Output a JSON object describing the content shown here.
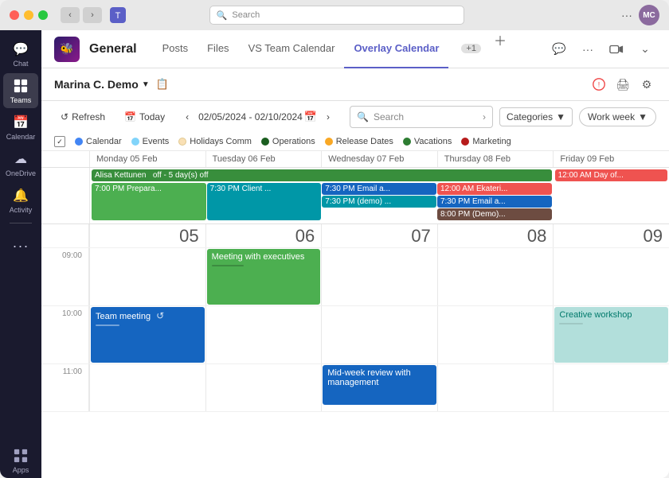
{
  "titlebar": {
    "search_placeholder": "Search",
    "more_label": "···",
    "teams_icon": "⊞"
  },
  "sidebar": {
    "items": [
      {
        "id": "chat",
        "label": "Chat",
        "icon": "💬",
        "active": false
      },
      {
        "id": "teams",
        "label": "Teams",
        "icon": "⊞",
        "active": true
      },
      {
        "id": "calendar",
        "label": "Calendar",
        "icon": "📅",
        "active": false
      },
      {
        "id": "onedrive",
        "label": "OneDrive",
        "icon": "☁",
        "active": false
      },
      {
        "id": "activity",
        "label": "Activity",
        "icon": "🔔",
        "active": false
      },
      {
        "id": "more",
        "label": "···",
        "icon": "···",
        "active": false
      },
      {
        "id": "apps",
        "label": "Apps",
        "icon": "⊞",
        "active": false
      }
    ]
  },
  "channel": {
    "logo": "🐝",
    "name": "General",
    "tabs": [
      {
        "id": "posts",
        "label": "Posts",
        "active": false
      },
      {
        "id": "files",
        "label": "Files",
        "active": false
      },
      {
        "id": "vs-team-calendar",
        "label": "VS Team Calendar",
        "active": false
      },
      {
        "id": "overlay-calendar",
        "label": "Overlay Calendar",
        "active": true
      },
      {
        "id": "plus-badge",
        "label": "+1",
        "active": false
      }
    ]
  },
  "calendar": {
    "user": "Marina C. Demo",
    "view": "Work week",
    "date_range": "02/05/2024 - 02/10/2024",
    "search_placeholder": "Search",
    "categories_label": "Categories",
    "refresh_label": "Refresh",
    "today_label": "Today",
    "legend": [
      {
        "id": "calendar",
        "label": "Calendar",
        "color": "#4285f4"
      },
      {
        "id": "events",
        "label": "Events",
        "color": "#81d4fa"
      },
      {
        "id": "holidays",
        "label": "Holidays Comm",
        "color": "#f9e0b5"
      },
      {
        "id": "operations",
        "label": "Operations",
        "color": "#1b5e20"
      },
      {
        "id": "release",
        "label": "Release Dates",
        "color": "#f9a825"
      },
      {
        "id": "vacations",
        "label": "Vacations",
        "color": "#2e7d32"
      },
      {
        "id": "marketing",
        "label": "Marketing",
        "color": "#b71c1c"
      }
    ],
    "days": [
      {
        "name": "Monday 05 Feb",
        "num": "05"
      },
      {
        "name": "Tuesday 06 Feb",
        "num": "06"
      },
      {
        "name": "Wednesday 07 Feb",
        "num": "07"
      },
      {
        "name": "Thursday 08 Feb",
        "num": "08"
      },
      {
        "name": "Friday 09 Feb",
        "num": "09"
      }
    ],
    "allday_events": [
      {
        "day": 0,
        "span": 5,
        "label": "Alisa Kettunen  off - 5 day(s) off",
        "color": "#388e3c",
        "text_color": "#fff"
      },
      {
        "day": 4,
        "span": 1,
        "label": "12:00 AM Day of...",
        "color": "#ef5350",
        "text_color": "#fff"
      }
    ],
    "timed_events": [
      {
        "day": 0,
        "time": "7:00 PM",
        "label": "7:00 PM Prepara...",
        "color": "#4caf50",
        "row": "evening"
      },
      {
        "day": 1,
        "time": "7:30 PM",
        "label": "7:30 PM Client ...",
        "color": "#0097a7",
        "row": "evening"
      },
      {
        "day": 2,
        "time": "7:30 PM",
        "label": "7:30 PM Email a...",
        "color": "#1565c0",
        "row": "evening"
      },
      {
        "day": 2,
        "time": "7:30 PM",
        "label": "7:30 PM (demo) ...",
        "color": "#0097a7",
        "row": "evening2"
      },
      {
        "day": 3,
        "time": "12:00 AM",
        "label": "12:00 AM Ekateri...",
        "color": "#ef5350",
        "row": "evening"
      },
      {
        "day": 3,
        "time": "7:30 PM",
        "label": "7:30 PM Email a...",
        "color": "#1565c0",
        "row": "evening2"
      },
      {
        "day": 3,
        "time": "8:00 PM",
        "label": "8:00 PM (Demo)...",
        "color": "#6d4c41",
        "row": "evening3"
      },
      {
        "day": 1,
        "label": "Meeting with executives",
        "color": "#4caf50",
        "slot": "09:00"
      },
      {
        "day": 0,
        "label": "Team meeting",
        "color": "#1565c0",
        "slot": "10:00"
      },
      {
        "day": 2,
        "label": "Mid-week review with management",
        "color": "#1565c0",
        "slot": "11:00"
      },
      {
        "day": 4,
        "label": "Creative workshop",
        "color": "#b2dfdb",
        "text_color": "#00796b",
        "slot": "10:00"
      }
    ]
  }
}
